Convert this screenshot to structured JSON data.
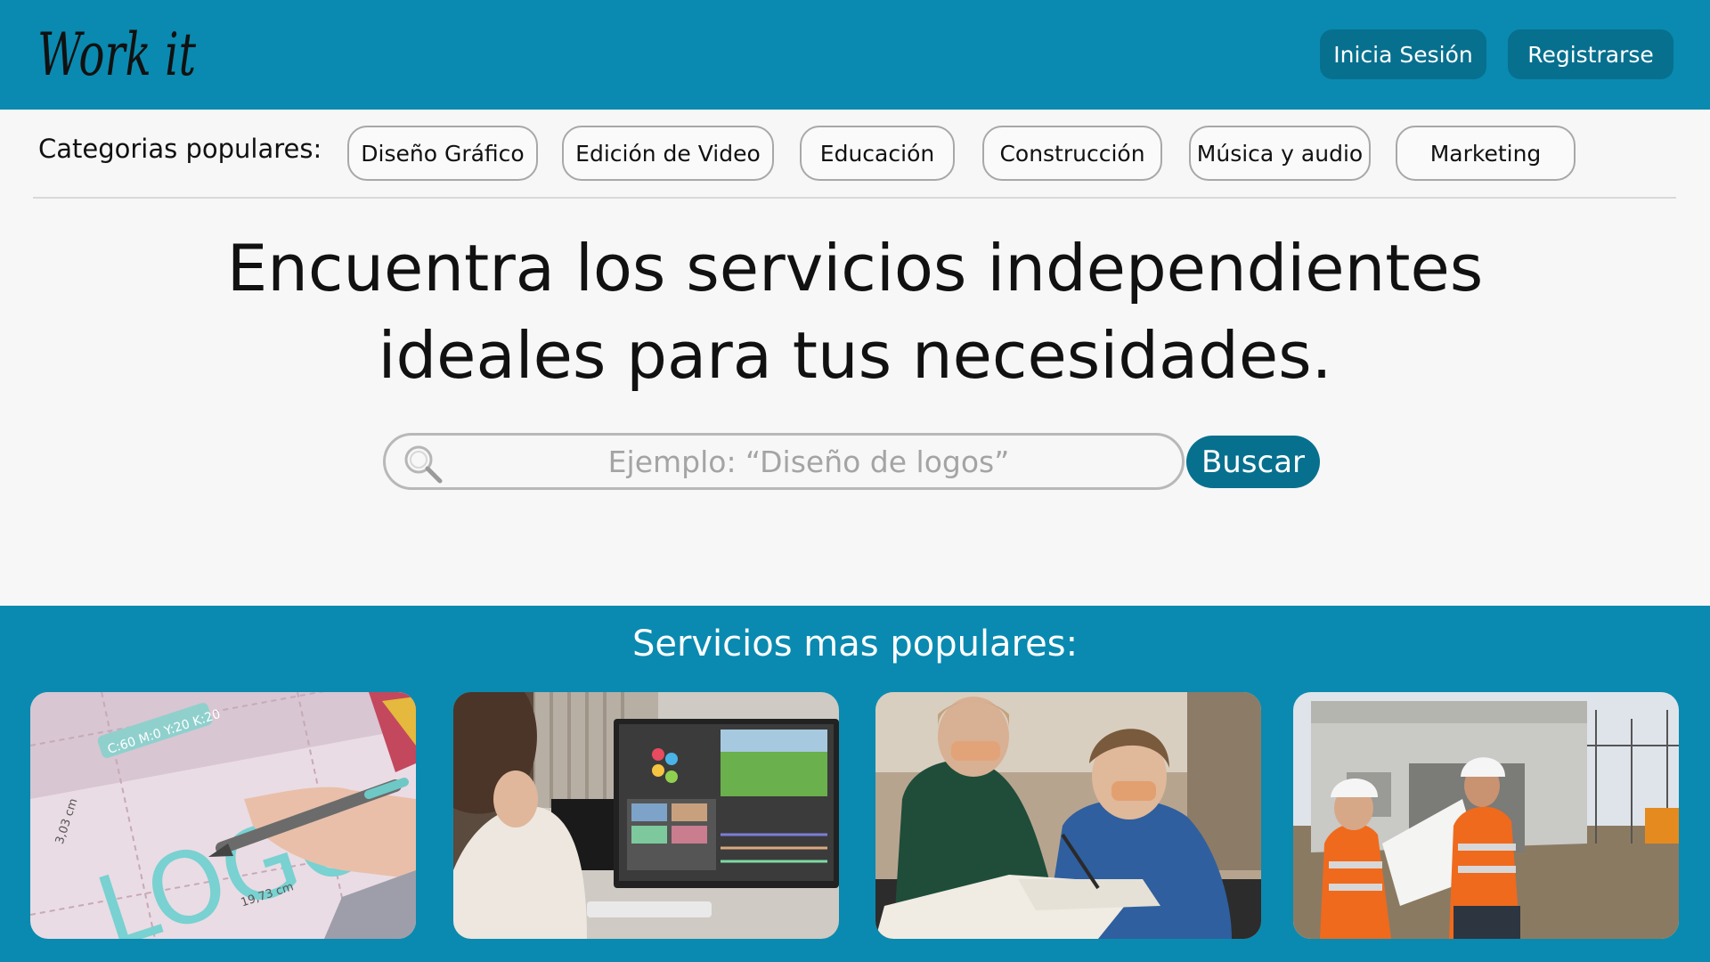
{
  "header": {
    "logo_text": "Work it",
    "login_label": "Inicia Sesión",
    "register_label": "Registrarse"
  },
  "categories": {
    "label": "Categorias populares:",
    "items": [
      "Diseño Gráfico",
      "Edición de Video",
      "Educación",
      "Construcción",
      "Música y audio",
      "Marketing"
    ]
  },
  "hero": {
    "title_line1": "Encuentra los servicios independientes",
    "title_line2": "ideales para tus necesidades."
  },
  "search": {
    "placeholder": "Ejemplo: “Diseño de logos”",
    "button_label": "Buscar"
  },
  "popular": {
    "title": "Servicios mas populares:",
    "cards": [
      {
        "image": "logo-design-photo",
        "text_logo": "LOGO",
        "text_measure1": "3,03 cm",
        "text_measure2": "19,73 cm",
        "text_swatch": "C:60 M:0 Y:20 K:20"
      },
      {
        "image": "video-editing-photo"
      },
      {
        "image": "education-photo"
      },
      {
        "image": "construction-photo"
      }
    ]
  },
  "colors": {
    "brand": "#0a8ab0",
    "brand_dark": "#07708f",
    "background": "#f7f7f7"
  }
}
